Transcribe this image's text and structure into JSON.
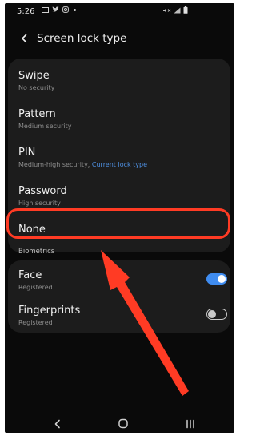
{
  "status_bar": {
    "time": "5:26",
    "left_icons": [
      "image-icon",
      "twitter-icon",
      "instagram-icon",
      "dot-icon"
    ],
    "right_icons": [
      "mute-icon",
      "signal-icon",
      "battery-icon"
    ]
  },
  "header": {
    "title": "Screen lock type"
  },
  "lock_types": [
    {
      "label": "Swipe",
      "sub": "No security"
    },
    {
      "label": "Pattern",
      "sub": "Medium security"
    },
    {
      "label": "PIN",
      "sub": "Medium-high security,",
      "sub_link": "Current lock type"
    },
    {
      "label": "Password",
      "sub": "High security"
    },
    {
      "label": "None"
    }
  ],
  "biometrics": {
    "section_title": "Biometrics",
    "items": [
      {
        "label": "Face",
        "sub": "Registered",
        "enabled": true
      },
      {
        "label": "Fingerprints",
        "sub": "Registered",
        "enabled": false
      }
    ]
  },
  "annotation": {
    "highlight_color": "#ff3b24"
  },
  "colors": {
    "accent": "#3f8cf0",
    "background": "#0a0a0a",
    "card": "#1c1c1c"
  }
}
